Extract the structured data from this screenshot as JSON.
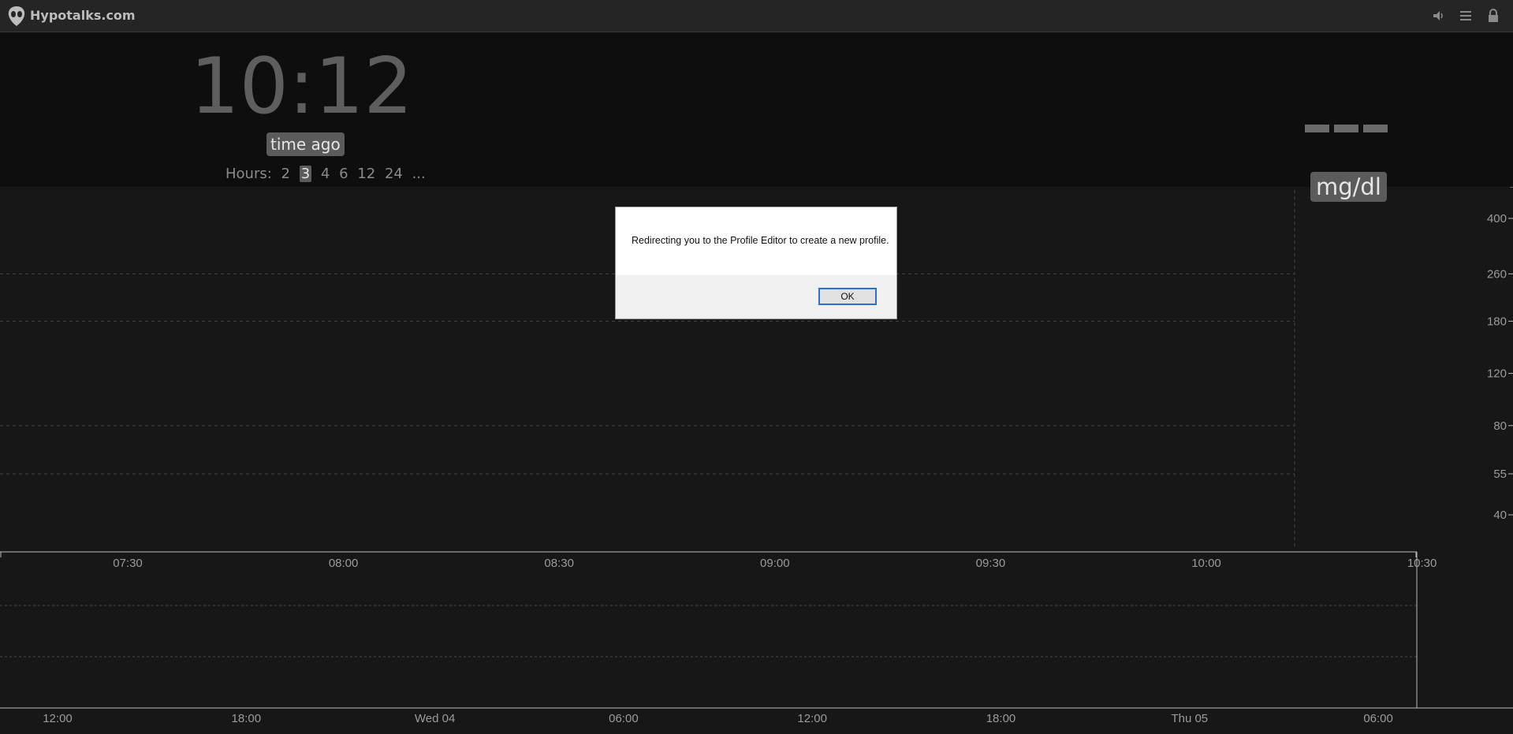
{
  "topbar": {
    "title": "Hypotalks.com",
    "icons": [
      "alien-logo-icon",
      "volume-icon",
      "menu-icon",
      "lock-icon"
    ]
  },
  "status": {
    "time": "10:12",
    "time_ago": "time ago",
    "hours_label": "Hours:",
    "hour_options": [
      "2",
      "3",
      "4",
      "6",
      "12",
      "24",
      "..."
    ],
    "selected_hour": "3",
    "bg_value": "---",
    "unit": "mg/dl"
  },
  "chart_data": [
    {
      "type": "line",
      "x_tick_labels": [
        "07:30",
        "08:00",
        "08:30",
        "09:00",
        "09:30",
        "10:00",
        "10:30"
      ],
      "y_tick_labels": [
        "400",
        "260",
        "180",
        "120",
        "80",
        "55",
        "40"
      ],
      "y_scale": "log",
      "grid": true,
      "series": []
    },
    {
      "type": "line",
      "x_tick_labels": [
        "12:00",
        "18:00",
        "Wed 04",
        "06:00",
        "12:00",
        "18:00",
        "Thu 05",
        "06:00"
      ],
      "series": []
    }
  ],
  "dialog": {
    "message": "Redirecting you to the Profile Editor to create a new profile.",
    "ok_label": "OK"
  },
  "colors": {
    "background": "#171717",
    "header_background": "#0e0e0e",
    "topbar": "#252525",
    "dialog_accent": "#2a6fd1"
  }
}
